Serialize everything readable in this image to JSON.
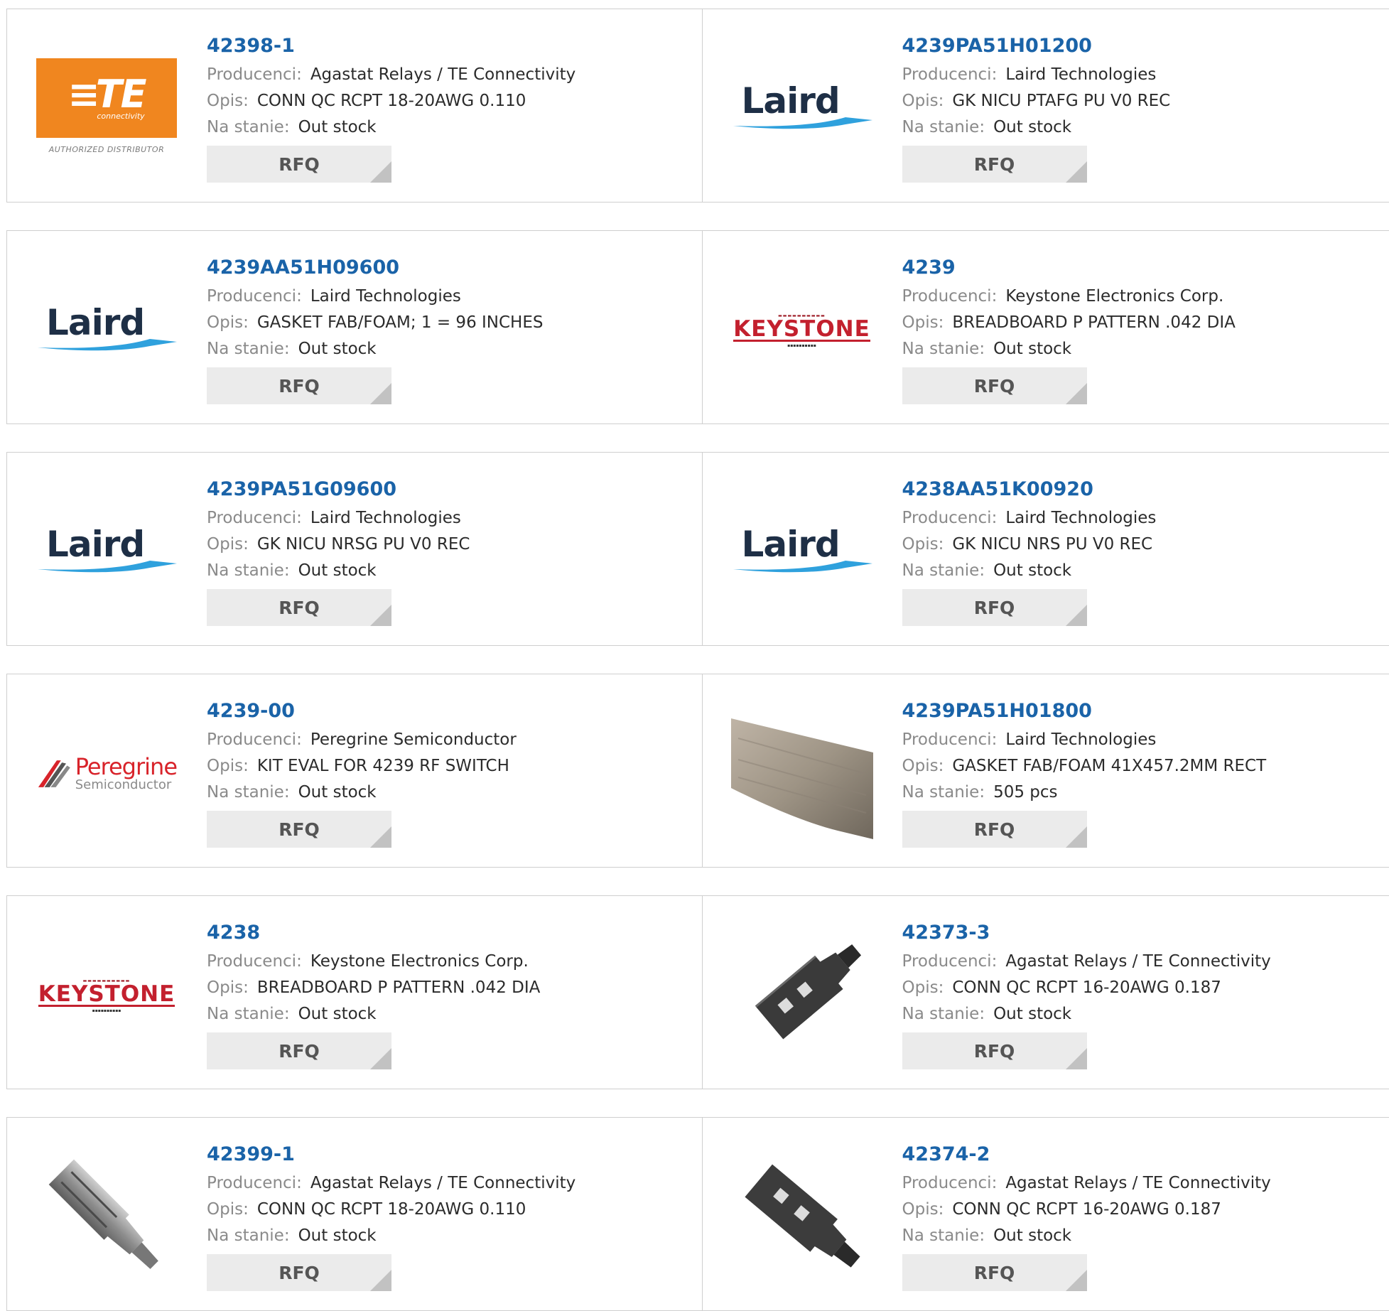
{
  "labels": {
    "manufacturer": "Producenci:",
    "description": "Opis:",
    "stock": "Na stanie:",
    "rfq": "RFQ"
  },
  "products": [
    {
      "part": "42398-1",
      "manufacturer": "Agastat Relays / TE Connectivity",
      "description": "CONN QC RCPT 18-20AWG 0.110",
      "stock": "Out stock",
      "image": "te-connectivity-logo",
      "logo_text": "TE",
      "logo_sub": "connectivity",
      "logo_caption": "AUTHORIZED DISTRIBUTOR"
    },
    {
      "part": "4239PA51H01200",
      "manufacturer": "Laird Technologies",
      "description": "GK NICU PTAFG PU V0 REC",
      "stock": "Out stock",
      "image": "laird-logo",
      "logo_text": "Laird"
    },
    {
      "part": "4239AA51H09600",
      "manufacturer": "Laird Technologies",
      "description": "GASKET FAB/FOAM; 1 = 96 INCHES",
      "stock": "Out stock",
      "image": "laird-logo",
      "logo_text": "Laird"
    },
    {
      "part": "4239",
      "manufacturer": "Keystone Electronics Corp.",
      "description": "BREADBOARD P PATTERN .042 DIA",
      "stock": "Out stock",
      "image": "keystone-logo",
      "logo_text": "KEYSTONE"
    },
    {
      "part": "4239PA51G09600",
      "manufacturer": "Laird Technologies",
      "description": "GK NICU NRSG PU V0 REC",
      "stock": "Out stock",
      "image": "laird-logo",
      "logo_text": "Laird"
    },
    {
      "part": "4238AA51K00920",
      "manufacturer": "Laird Technologies",
      "description": "GK NICU NRS PU V0 REC",
      "stock": "Out stock",
      "image": "laird-logo",
      "logo_text": "Laird"
    },
    {
      "part": "4239-00",
      "manufacturer": "Peregrine Semiconductor",
      "description": "KIT EVAL FOR 4239 RF SWITCH",
      "stock": "Out stock",
      "image": "peregrine-logo",
      "logo_text": "Peregrine",
      "logo_sub": "Semiconductor"
    },
    {
      "part": "4239PA51H01800",
      "manufacturer": "Laird Technologies",
      "description": "GASKET FAB/FOAM 41X457.2MM RECT",
      "stock": "505 pcs",
      "image": "gasket-strip-photo"
    },
    {
      "part": "4238",
      "manufacturer": "Keystone Electronics Corp.",
      "description": "BREADBOARD P PATTERN .042 DIA",
      "stock": "Out stock",
      "image": "keystone-logo",
      "logo_text": "KEYSTONE"
    },
    {
      "part": "42373-3",
      "manufacturer": "Agastat Relays / TE Connectivity",
      "description": "CONN QC RCPT 16-20AWG 0.187",
      "stock": "Out stock",
      "image": "dark-connector-photo"
    },
    {
      "part": "42399-1",
      "manufacturer": "Agastat Relays / TE Connectivity",
      "description": "CONN QC RCPT 18-20AWG 0.110",
      "stock": "Out stock",
      "image": "silver-connector-photo"
    },
    {
      "part": "42374-2",
      "manufacturer": "Agastat Relays / TE Connectivity",
      "description": "CONN QC RCPT 16-20AWG 0.187",
      "stock": "Out stock",
      "image": "dark-connector-photo"
    }
  ],
  "colors": {
    "link": "#1a63a8",
    "border": "#cfcfcf",
    "button_bg": "#ebebeb"
  }
}
